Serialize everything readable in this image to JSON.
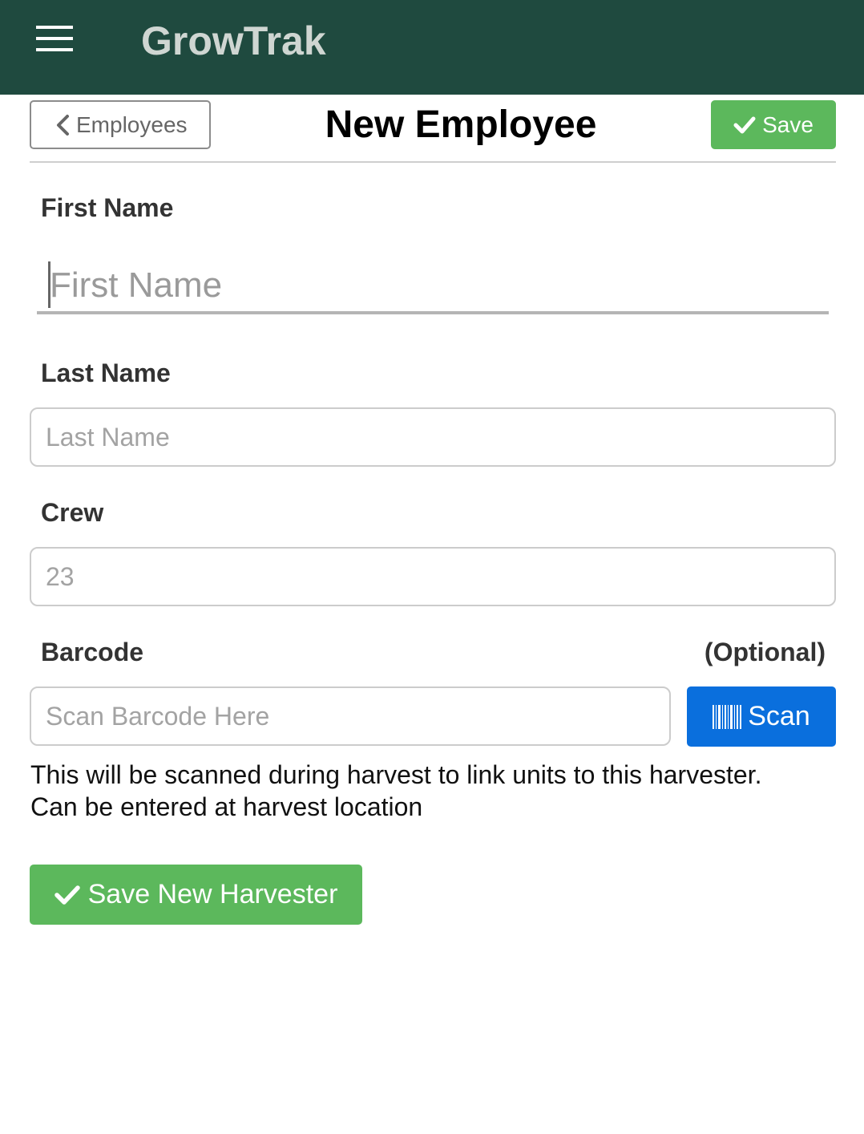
{
  "app": {
    "title": "GrowTrak"
  },
  "header": {
    "back_label": "Employees",
    "page_title": "New Employee",
    "save_label": "Save"
  },
  "form": {
    "first_name": {
      "label": "First Name",
      "placeholder": "First Name",
      "value": ""
    },
    "last_name": {
      "label": "Last Name",
      "placeholder": "Last Name",
      "value": ""
    },
    "crew": {
      "label": "Crew",
      "placeholder": "23",
      "value": ""
    },
    "barcode": {
      "label": "Barcode",
      "optional_label": "(Optional)",
      "placeholder": "Scan Barcode Here",
      "value": "",
      "scan_label": "Scan",
      "help_line1": "This will be scanned during harvest to link units to this harvester.",
      "help_line2": "Can be entered at harvest location"
    },
    "submit_label": "Save New Harvester"
  },
  "colors": {
    "app_bar": "#1f4a3f",
    "success": "#5cb85c",
    "primary": "#0a6fdd"
  },
  "icons": {
    "menu": "menu-icon",
    "back": "chevron-left-icon",
    "save": "check-icon",
    "scan": "barcode-icon"
  }
}
